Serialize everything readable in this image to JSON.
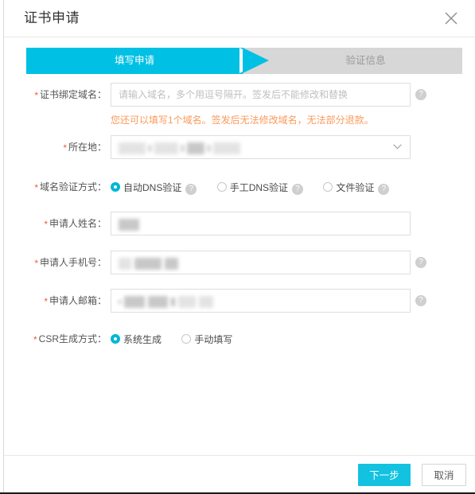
{
  "dialog": {
    "title": "证书申请",
    "close_icon": "close-icon"
  },
  "steps": {
    "current": 1,
    "items": [
      {
        "label": "填写申请",
        "state": "active"
      },
      {
        "label": "验证信息",
        "state": "inactive"
      }
    ],
    "active_color": "#00c0e4",
    "inactive_color": "#d7d7d7"
  },
  "form": {
    "domain": {
      "label": "证书绑定域名：",
      "required": true,
      "value": "",
      "placeholder": "请输入域名，多个用逗号隔开。签发后不能修改和替换",
      "help": "?",
      "warning": "您还可以填写1个域名。签发后无法修改域名，无法部分退款。",
      "warning_color": "#fb9a5b"
    },
    "location": {
      "label": "所在地：",
      "required": true,
      "value": "",
      "redacted": true,
      "chevron_icon": "chevron-down-icon"
    },
    "verify_method": {
      "label": "域名验证方式：",
      "required": true,
      "selected": "自动DNS验证",
      "options": [
        {
          "label": "自动DNS验证",
          "selected": true,
          "help": "?"
        },
        {
          "label": "手工DNS验证",
          "selected": false,
          "help": "?"
        },
        {
          "label": "文件验证",
          "selected": false,
          "help": "?"
        }
      ]
    },
    "applicant_name": {
      "label": "申请人姓名：",
      "required": true,
      "value": "",
      "redacted": true
    },
    "applicant_phone": {
      "label": "申请人手机号：",
      "required": true,
      "value": "",
      "redacted": true,
      "help": "?"
    },
    "applicant_email": {
      "label": "申请人邮箱：",
      "required": true,
      "value": "",
      "redacted": true,
      "help": "?"
    },
    "csr_method": {
      "label": "CSR生成方式：",
      "required": true,
      "selected": "系统生成",
      "options": [
        {
          "label": "系统生成",
          "selected": true
        },
        {
          "label": "手动填写",
          "selected": false
        }
      ]
    },
    "required_marker": "*"
  },
  "footer": {
    "next_label": "下一步",
    "cancel_label": "取消",
    "primary_color": "#13c2e0"
  }
}
